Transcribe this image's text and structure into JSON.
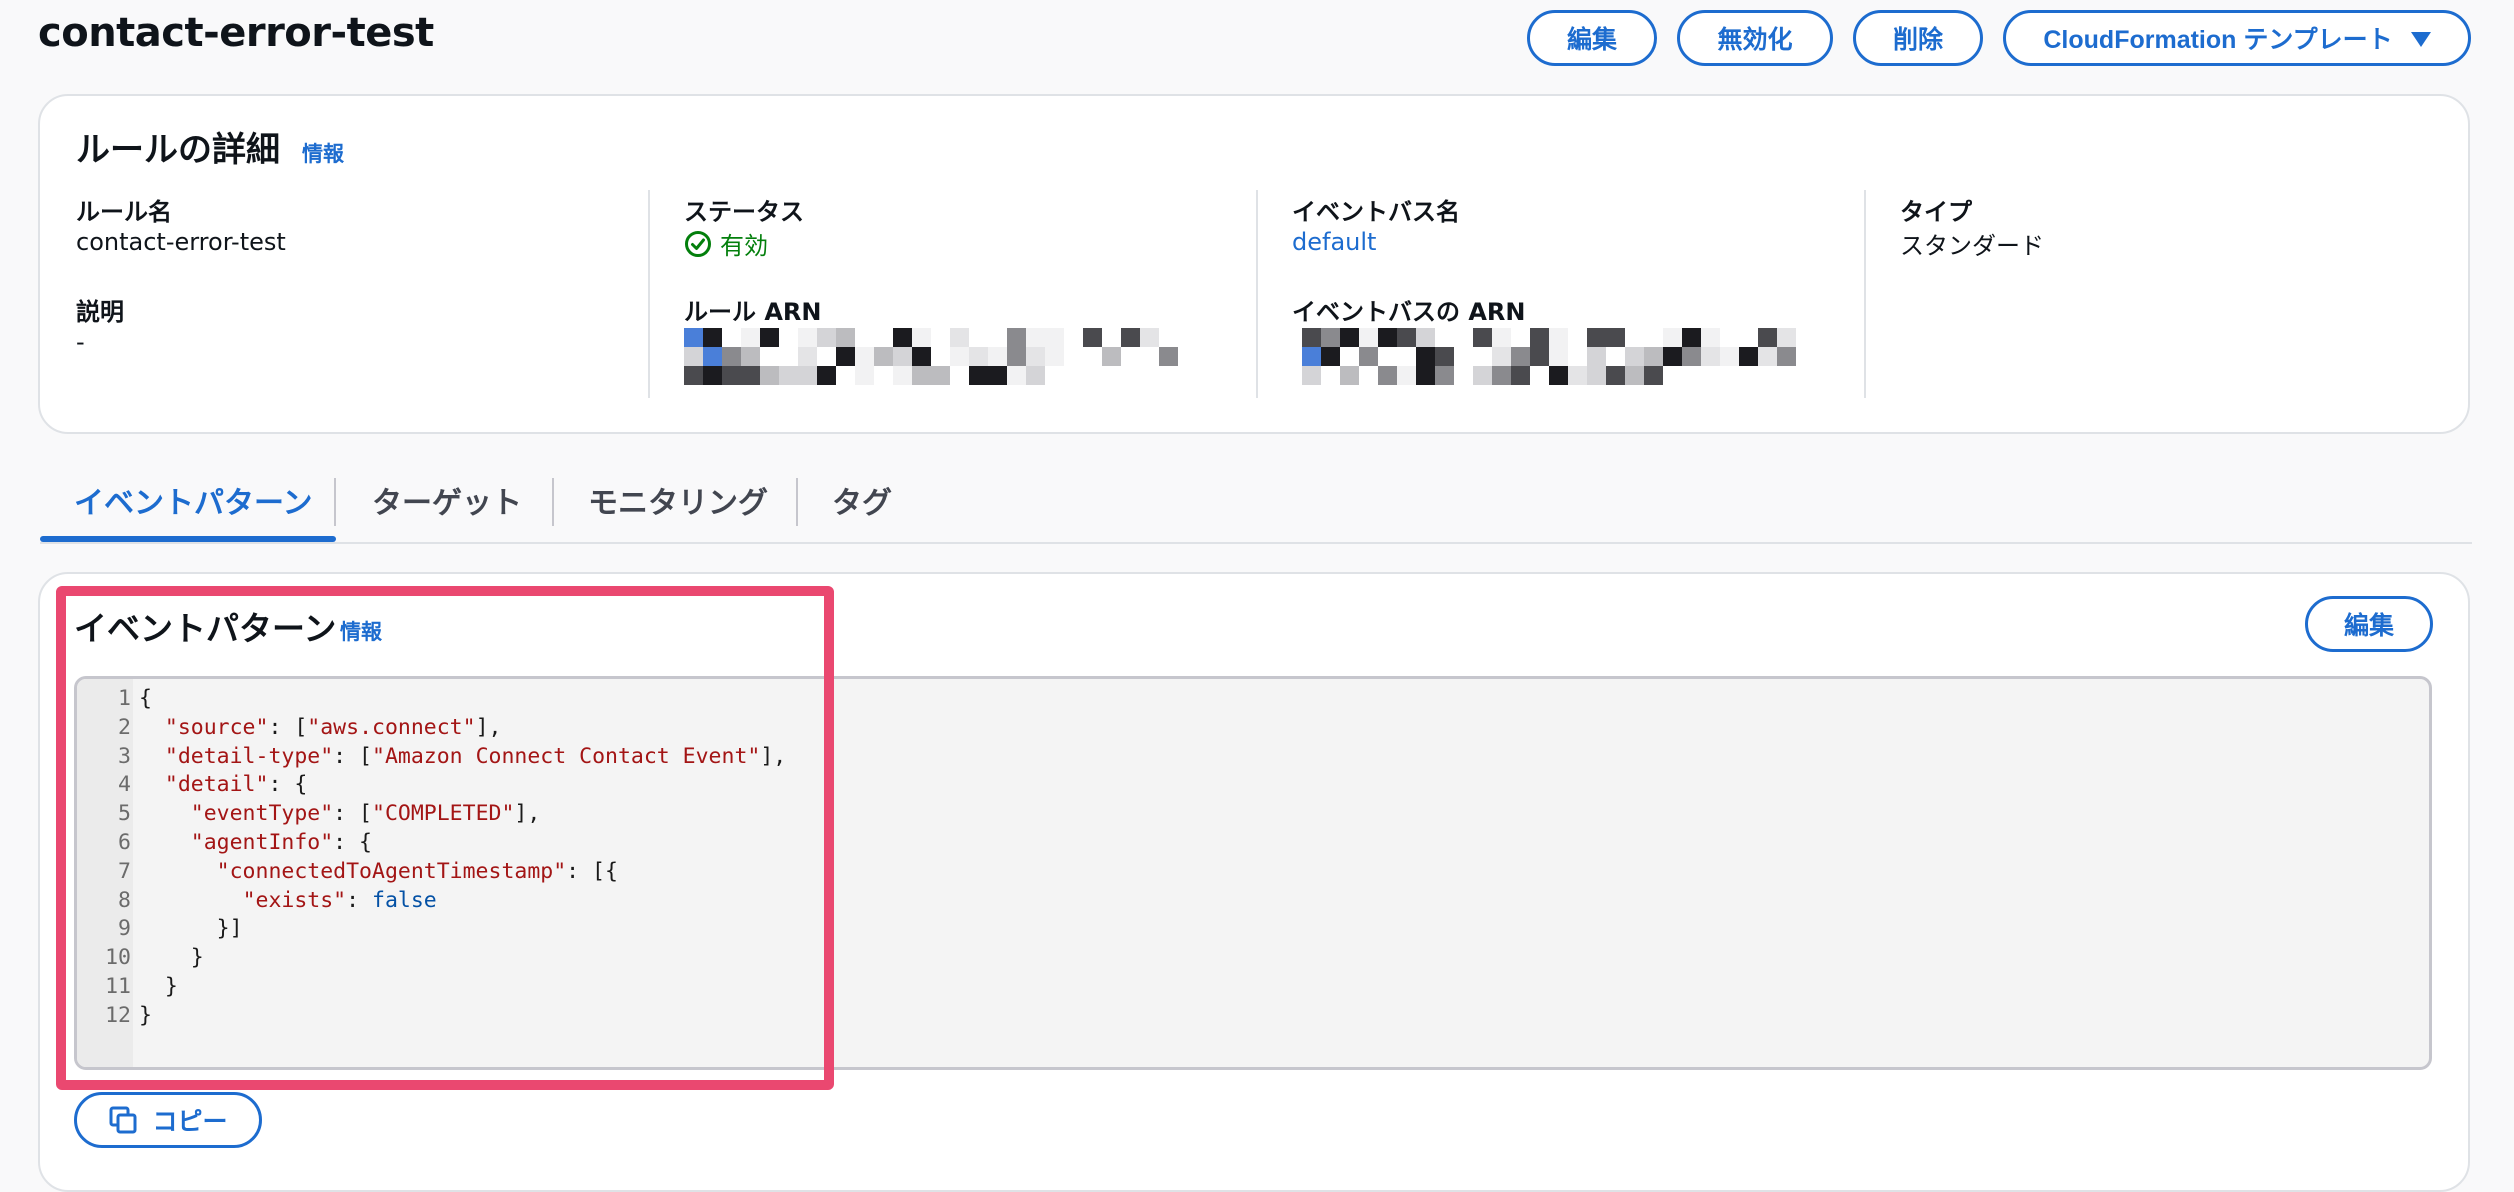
{
  "page": {
    "title": "contact-error-test"
  },
  "header_actions": {
    "edit": "編集",
    "disable": "無効化",
    "delete": "削除",
    "cloudformation": "CloudFormation テンプレート"
  },
  "rule_details": {
    "title": "ルールの詳細",
    "info": "情報",
    "rule_name_label": "ルール名",
    "rule_name_value": "contact-error-test",
    "description_label": "説明",
    "description_value": "-",
    "status_label": "ステータス",
    "status_value": "有効",
    "rule_arn_label": "ルール ARN",
    "event_bus_label": "イベントバス名",
    "event_bus_value": "default",
    "event_bus_arn_label": "イベントバスの ARN",
    "type_label": "タイプ",
    "type_value": "スタンダード"
  },
  "tabs": [
    {
      "label": "イベントパターン",
      "active": true
    },
    {
      "label": "ターゲット",
      "active": false
    },
    {
      "label": "モニタリング",
      "active": false
    },
    {
      "label": "タグ",
      "active": false
    }
  ],
  "event_pattern": {
    "title": "イベントパターン",
    "info": "情報",
    "edit": "編集",
    "copy": "コピー",
    "code_lines": [
      {
        "n": "1",
        "t": "{"
      },
      {
        "n": "2",
        "t": "  \"source\": [\"aws.connect\"],"
      },
      {
        "n": "3",
        "t": "  \"detail-type\": [\"Amazon Connect Contact Event\"],"
      },
      {
        "n": "4",
        "t": "  \"detail\": {"
      },
      {
        "n": "5",
        "t": "    \"eventType\": [\"COMPLETED\"],"
      },
      {
        "n": "6",
        "t": "    \"agentInfo\": {"
      },
      {
        "n": "7",
        "t": "      \"connectedToAgentTimestamp\": [{"
      },
      {
        "n": "8",
        "t": "        \"exists\": false"
      },
      {
        "n": "9",
        "t": "      }]"
      },
      {
        "n": "10",
        "t": "    }"
      },
      {
        "n": "11",
        "t": "  }"
      },
      {
        "n": "12",
        "t": "}"
      }
    ]
  },
  "colors": {
    "accent": "#1d6ccf",
    "status_ok": "#037f0c",
    "highlight": "#ea4870"
  },
  "icons": {
    "status": "check-circle-icon",
    "dropdown": "caret-down-icon",
    "copy": "copy-icon"
  }
}
